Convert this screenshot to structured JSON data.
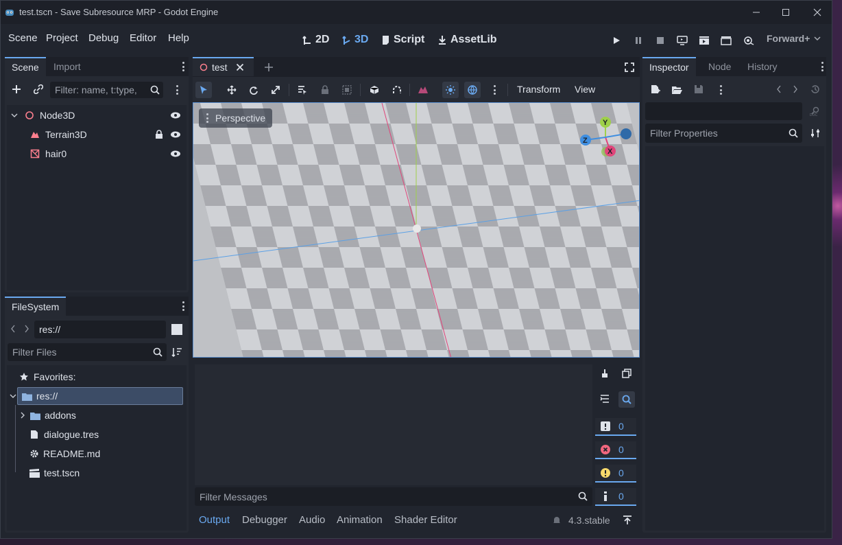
{
  "window": {
    "title": "test.tscn - Save Subresource MRP - Godot Engine"
  },
  "menu": {
    "items": [
      "Scene",
      "Project",
      "Debug",
      "Editor",
      "Help"
    ]
  },
  "workspaces": {
    "two_d": "2D",
    "three_d": "3D",
    "script": "Script",
    "assetlib": "AssetLib",
    "active": "3D"
  },
  "renderer": {
    "label": "Forward+"
  },
  "scene_dock": {
    "tabs": [
      "Scene",
      "Import"
    ],
    "filter_placeholder": "Filter: name, t:type,",
    "nodes": [
      {
        "name": "Node3D",
        "icon": "node3d-icon"
      },
      {
        "name": "Terrain3D",
        "icon": "terrain-icon"
      },
      {
        "name": "hair0",
        "icon": "mesh-icon"
      }
    ]
  },
  "filesystem_dock": {
    "tab": "FileSystem",
    "path": "res://",
    "filter_placeholder": "Filter Files",
    "favorites_label": "Favorites:",
    "root": "res://",
    "entries": [
      {
        "name": "addons",
        "icon": "folder-icon"
      },
      {
        "name": "dialogue.tres",
        "icon": "file-icon"
      },
      {
        "name": "README.md",
        "icon": "gear-icon"
      },
      {
        "name": "test.tscn",
        "icon": "clapperboard-icon"
      }
    ]
  },
  "editor": {
    "scene_tab": "test",
    "viewport_label": "Perspective",
    "toolbar": {
      "transform_label": "Transform",
      "view_label": "View"
    },
    "gizmo": {
      "x": "X",
      "y": "Y",
      "z": "Z"
    }
  },
  "output": {
    "filter_placeholder": "Filter Messages",
    "counts": {
      "errors_total": "0",
      "errors": "0",
      "warnings": "0",
      "info": "0"
    },
    "bottom_tabs": [
      "Output",
      "Debugger",
      "Audio",
      "Animation",
      "Shader Editor"
    ],
    "active_tab": "Output",
    "version": "4.3.stable"
  },
  "inspector": {
    "tabs": [
      "Inspector",
      "Node",
      "History"
    ],
    "filter_placeholder": "Filter Properties"
  },
  "colors": {
    "accent": "#6aa9f0",
    "background": "#21252e",
    "panel": "#262a33"
  }
}
